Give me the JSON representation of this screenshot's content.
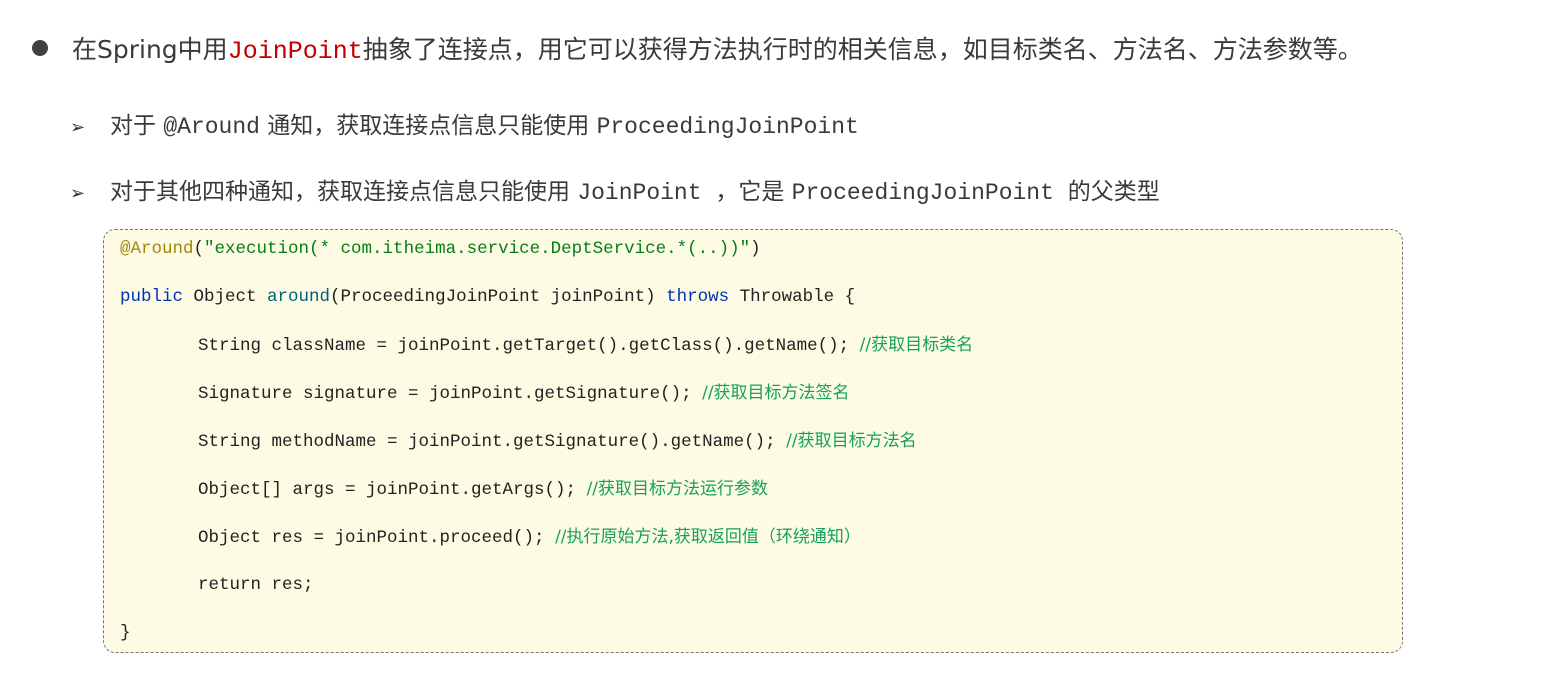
{
  "main_point": {
    "prefix": "在Spring中用",
    "highlight": "JoinPoint",
    "suffix": "抽象了连接点，用它可以获得方法执行时的相关信息，如目标类名、方法名、方法参数等。"
  },
  "sub_points": [
    {
      "parts": [
        {
          "t": "对于 ",
          "m": false
        },
        {
          "t": "@Around",
          "m": true
        },
        {
          "t": " 通知，获取连接点信息只能使用 ",
          "m": false
        },
        {
          "t": " ProceedingJoinPoint",
          "m": true
        }
      ]
    },
    {
      "parts": [
        {
          "t": "对于其他四种通知，获取连接点信息只能使用 ",
          "m": false
        },
        {
          "t": "JoinPoint ",
          "m": true
        },
        {
          "t": "，它是 ",
          "m": false
        },
        {
          "t": "ProceedingJoinPoint ",
          "m": true
        },
        {
          "t": "的父类型",
          "m": false
        }
      ]
    }
  ],
  "code_lines": [
    {
      "indent": false,
      "tokens": [
        [
          "ann",
          "@Around"
        ],
        [
          "pl",
          "("
        ],
        [
          "str",
          "\"execution(* com.itheima.service.DeptService.*(..))\""
        ],
        [
          "pl",
          ")"
        ]
      ]
    },
    {
      "indent": false,
      "tokens": [
        [
          "kw",
          "public "
        ],
        [
          "pl",
          "Object "
        ],
        [
          "fn",
          "around"
        ],
        [
          "pl",
          "(ProceedingJoinPoint joinPoint) "
        ],
        [
          "kw",
          "throws "
        ],
        [
          "pl",
          "Throwable {"
        ]
      ]
    },
    {
      "indent": true,
      "tokens": [
        [
          "pl",
          "String className = joinPoint.getTarget().getClass().getName(); "
        ],
        [
          "cm",
          "//获取目标类名"
        ]
      ]
    },
    {
      "indent": true,
      "tokens": [
        [
          "pl",
          "Signature signature = joinPoint.getSignature(); "
        ],
        [
          "cm",
          "//获取目标方法签名"
        ]
      ]
    },
    {
      "indent": true,
      "tokens": [
        [
          "pl",
          "String methodName = joinPoint.getSignature().getName(); "
        ],
        [
          "cm",
          "//获取目标方法名"
        ]
      ]
    },
    {
      "indent": true,
      "tokens": [
        [
          "pl",
          "Object[] args = joinPoint.getArgs(); "
        ],
        [
          "cm",
          "//获取目标方法运行参数"
        ]
      ]
    },
    {
      "indent": true,
      "tokens": [
        [
          "pl",
          "Object res = joinPoint.proceed(); "
        ],
        [
          "cm",
          "//执行原始方法,获取返回值（环绕通知）"
        ]
      ]
    },
    {
      "indent": true,
      "tokens": [
        [
          "pl",
          "return res;"
        ]
      ]
    },
    {
      "indent": false,
      "tokens": [
        [
          "pl",
          "}"
        ]
      ]
    }
  ],
  "colors": {
    "highlight": "#c00000",
    "code_bg": "#fefbe4",
    "annotation": "#9e880d",
    "string": "#067d17",
    "keyword": "#0033b3",
    "comment": "#17a05d"
  }
}
